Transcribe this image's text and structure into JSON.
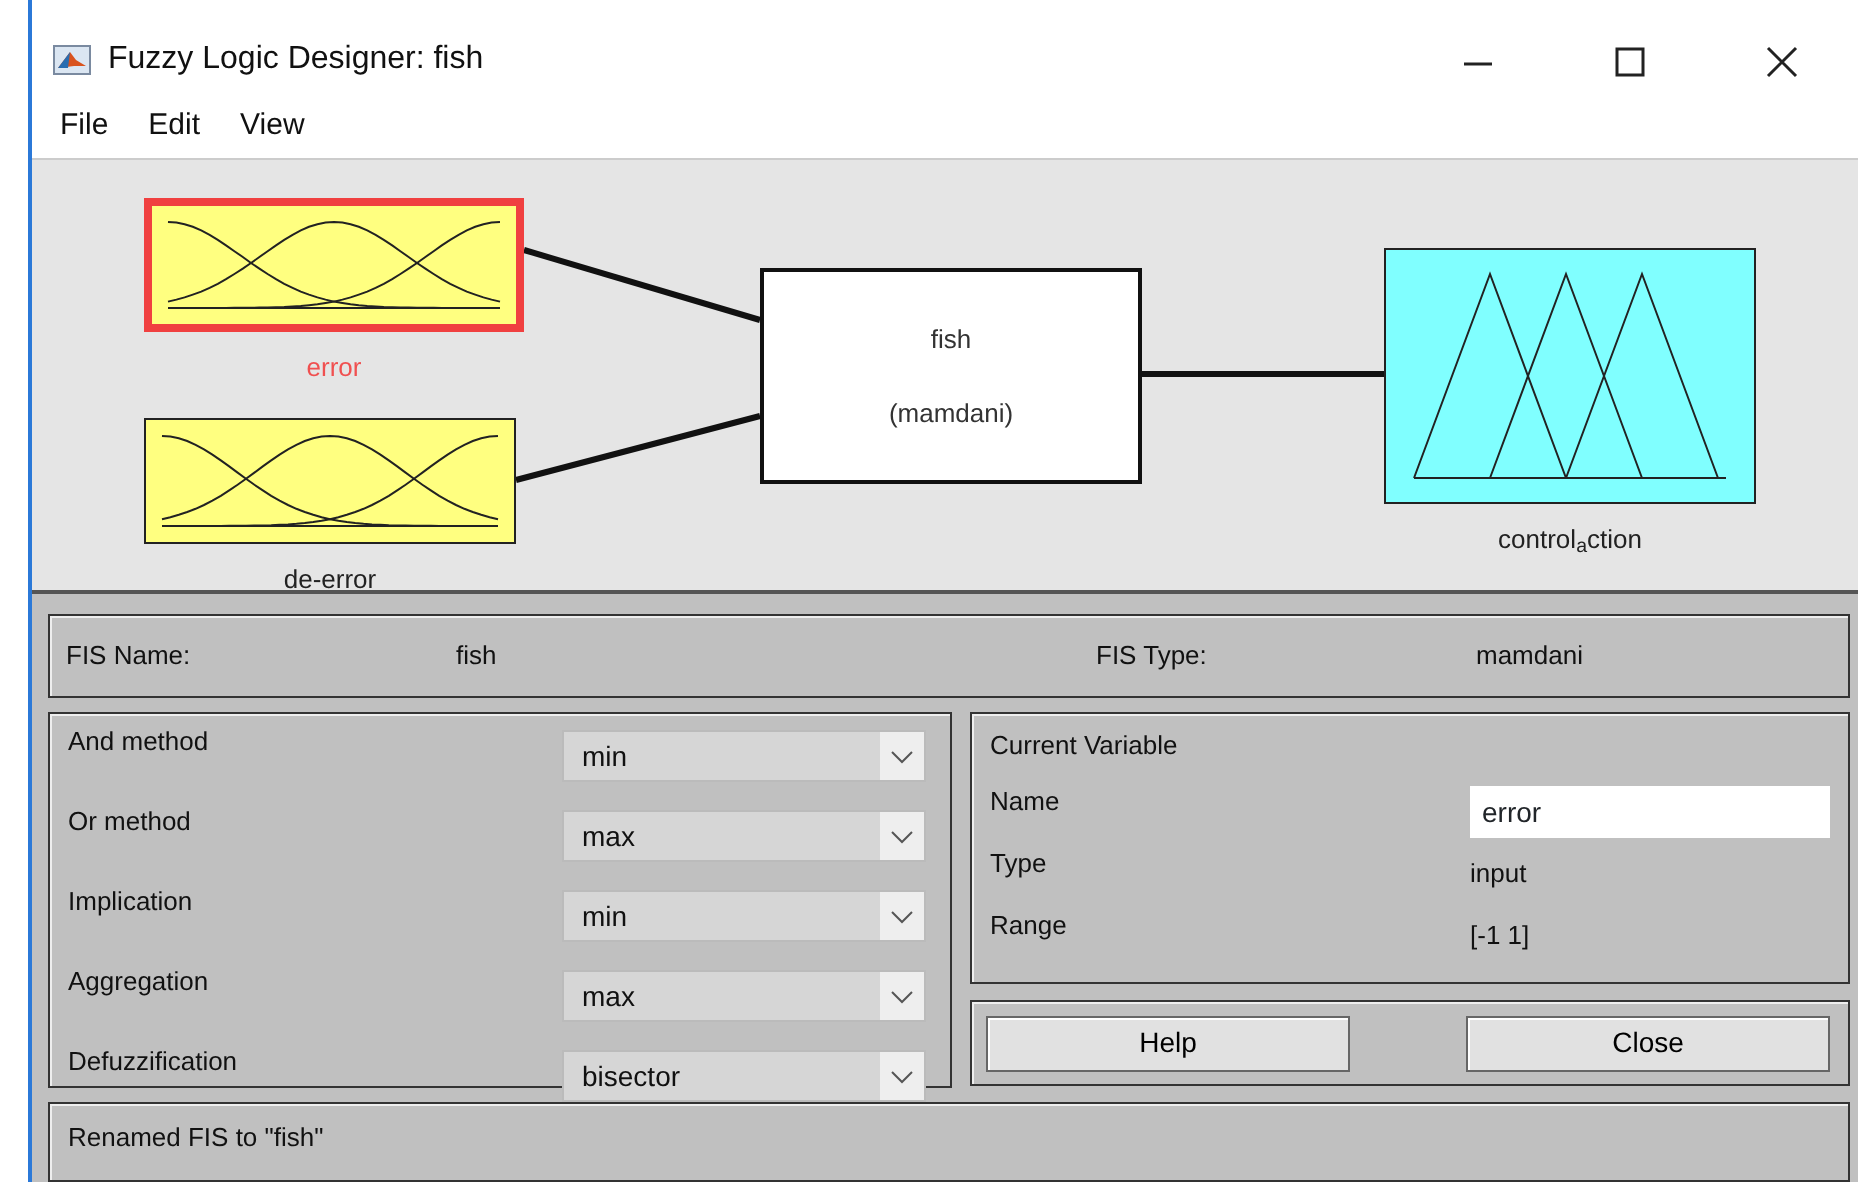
{
  "window": {
    "title": "Fuzzy Logic Designer: fish"
  },
  "menu": [
    "File",
    "Edit",
    "View"
  ],
  "diagram": {
    "inputs": [
      {
        "label": "error",
        "selected": true
      },
      {
        "label": "de-error",
        "selected": false
      }
    ],
    "system": {
      "name": "fish",
      "type": "(mamdani)"
    },
    "outputs": [
      {
        "label": "control$_{a}$ction",
        "selected": false
      }
    ]
  },
  "fis_info": {
    "name_label": "FIS Name:",
    "name_value": "fish",
    "type_label": "FIS Type:",
    "type_value": "mamdani"
  },
  "methods": [
    {
      "label": "And method",
      "value": "min"
    },
    {
      "label": "Or method",
      "value": "max"
    },
    {
      "label": "Implication",
      "value": "min"
    },
    {
      "label": "Aggregation",
      "value": "max"
    },
    {
      "label": "Defuzzification",
      "value": "bisector"
    }
  ],
  "current_variable": {
    "title": "Current Variable",
    "rows": [
      {
        "label": "Name",
        "value": "error",
        "kind": "field"
      },
      {
        "label": "Type",
        "value": "input",
        "kind": "text"
      },
      {
        "label": "Range",
        "value": "[-1 1]",
        "kind": "text"
      }
    ]
  },
  "buttons": [
    "Help",
    "Close"
  ],
  "status": "Renamed FIS to \"fish\""
}
